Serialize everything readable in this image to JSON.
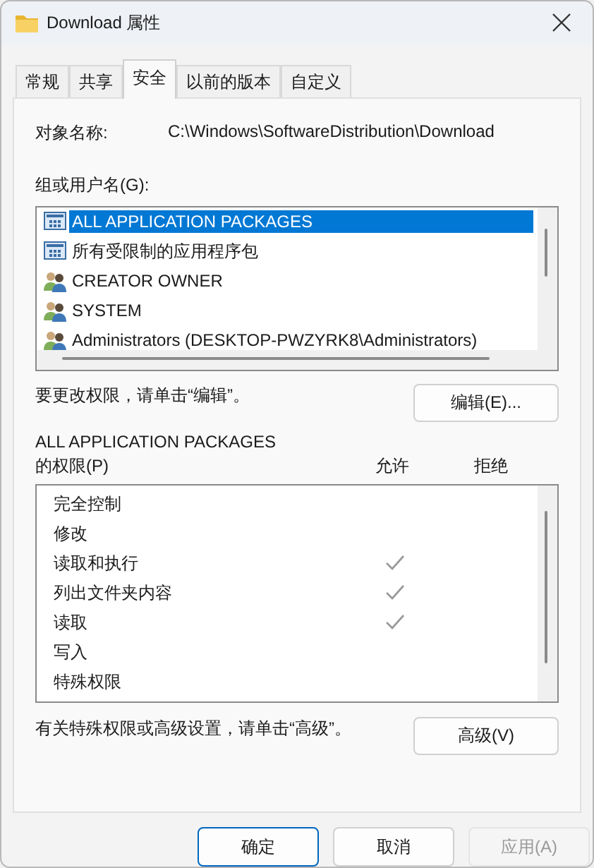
{
  "window": {
    "title": "Download 属性"
  },
  "tabs": [
    {
      "label": "常规",
      "selected": false
    },
    {
      "label": "共享",
      "selected": false
    },
    {
      "label": "安全",
      "selected": true
    },
    {
      "label": "以前的版本",
      "selected": false
    },
    {
      "label": "自定义",
      "selected": false
    }
  ],
  "object_name": {
    "label": "对象名称:",
    "value": "C:\\Windows\\SoftwareDistribution\\Download"
  },
  "groups": {
    "label": "组或用户名(G):",
    "items": [
      {
        "name": "ALL APPLICATION PACKAGES",
        "kind": "package",
        "selected": true
      },
      {
        "name": "所有受限制的应用程序包",
        "kind": "package",
        "selected": false
      },
      {
        "name": "CREATOR OWNER",
        "kind": "user",
        "selected": false
      },
      {
        "name": "SYSTEM",
        "kind": "user",
        "selected": false
      },
      {
        "name": "Administrators (DESKTOP-PWZYRK8\\Administrators)",
        "kind": "user",
        "selected": false
      }
    ]
  },
  "edit_hint": "要更改权限，请单击“编辑”。",
  "edit_button": "编辑(E)...",
  "permissions": {
    "title": "ALL APPLICATION PACKAGES",
    "label": "的权限(P)",
    "allow_header": "允许",
    "deny_header": "拒绝",
    "items": [
      {
        "name": "完全控制",
        "allow": false,
        "deny": false
      },
      {
        "name": "修改",
        "allow": false,
        "deny": false
      },
      {
        "name": "读取和执行",
        "allow": true,
        "deny": false
      },
      {
        "name": "列出文件夹内容",
        "allow": true,
        "deny": false
      },
      {
        "name": "读取",
        "allow": true,
        "deny": false
      },
      {
        "name": "写入",
        "allow": false,
        "deny": false
      },
      {
        "name": "特殊权限",
        "allow": false,
        "deny": false
      }
    ]
  },
  "advanced_hint": "有关特殊权限或高级设置，请单击“高级”。",
  "advanced_button": "高级(V)",
  "buttons": [
    {
      "label": "确定",
      "default": true,
      "disabled": false
    },
    {
      "label": "取消",
      "default": false,
      "disabled": false
    },
    {
      "label": "应用(A)",
      "default": false,
      "disabled": true
    }
  ]
}
